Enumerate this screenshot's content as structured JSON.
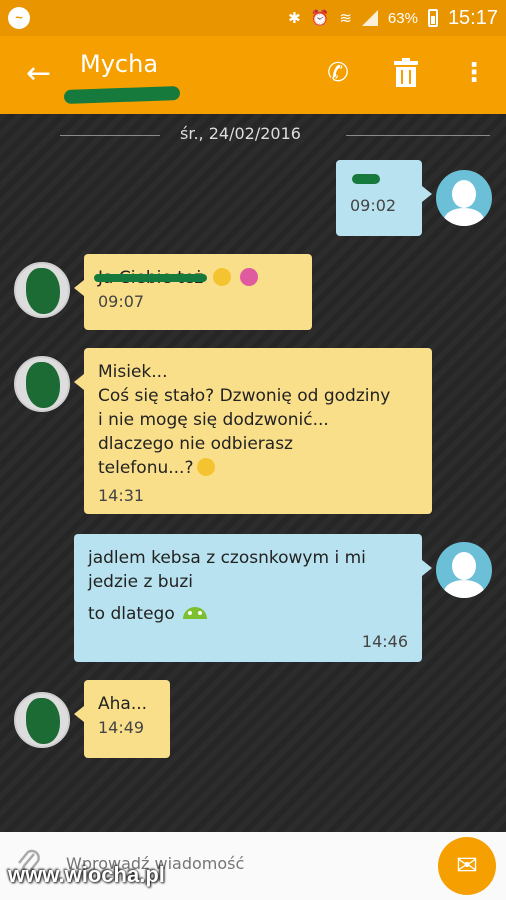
{
  "status_bar": {
    "battery": "63%",
    "time": "15:17",
    "icons": [
      "messenger-icon",
      "bluetooth-icon",
      "alarm-icon",
      "wifi-icon",
      "signal-icon",
      "battery-icon"
    ]
  },
  "app_bar": {
    "title": "Mycha",
    "back_icon": "←",
    "call_icon": "✆",
    "delete_icon": "🗑",
    "menu_icon": "⋮"
  },
  "conversation": {
    "date": "śr., 24/02/2016",
    "messages": [
      {
        "direction": "out",
        "text": "",
        "time": "09:02"
      },
      {
        "direction": "in",
        "text": "Ja Ciebie też",
        "time": "09:07"
      },
      {
        "direction": "in",
        "lines": [
          "Misiek...",
          "Coś się stało? Dzwonię od godziny",
          "i nie mogę się dodzwonić...",
          "dlaczego nie odbierasz",
          "telefonu...?"
        ],
        "time": "14:31"
      },
      {
        "direction": "out",
        "lines": [
          "jadlem kebsa z czosnkowym i mi",
          "jedzie z buzi",
          "to dlatego"
        ],
        "time": "14:46"
      },
      {
        "direction": "in",
        "text": "Aha...",
        "time": "14:49"
      }
    ]
  },
  "composer": {
    "placeholder": "Wprowadź wiadomość",
    "attach_icon": "📎",
    "send_icon": "✉"
  },
  "watermark": "www.wiocha.pl",
  "colors": {
    "accent": "#f5a000",
    "incoming_bubble": "#f9df8a",
    "outgoing_bubble": "#b8e2ef"
  }
}
